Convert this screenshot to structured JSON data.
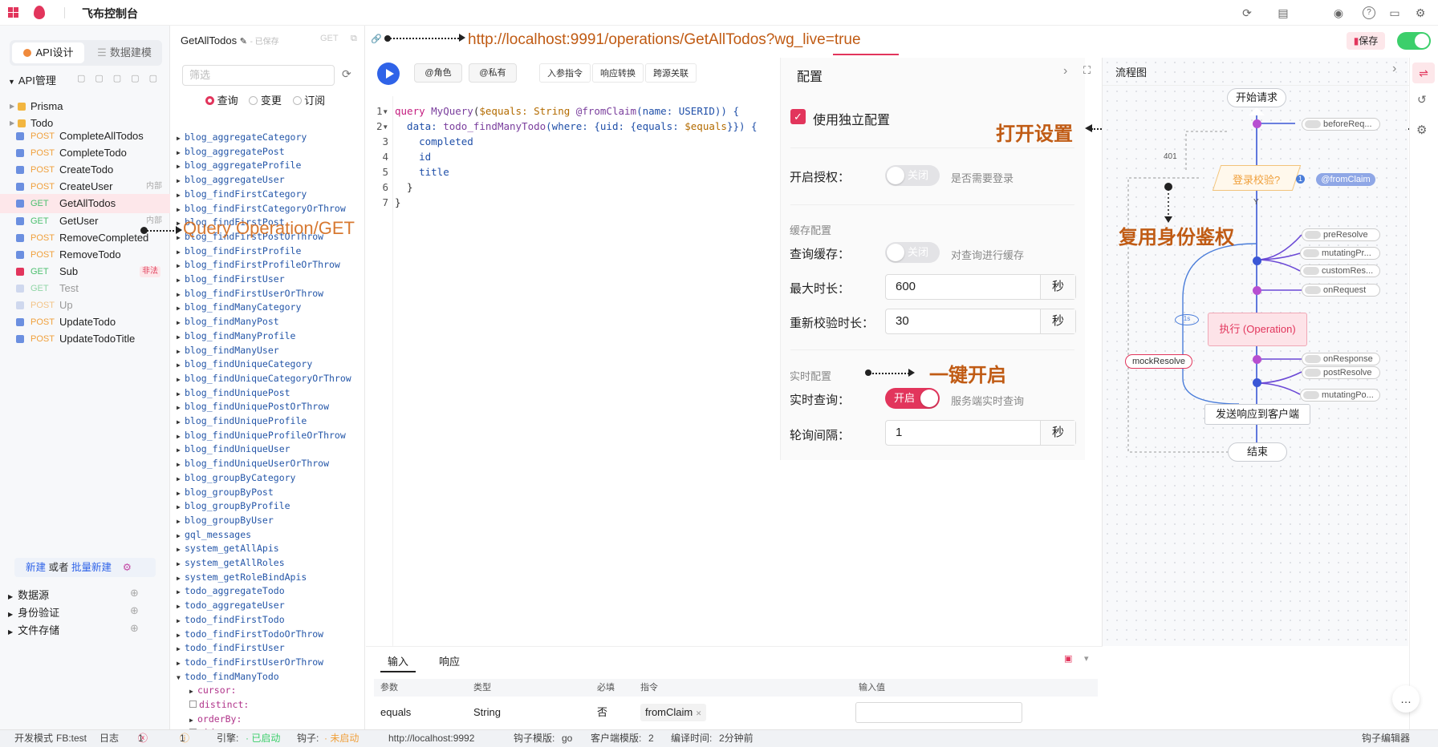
{
  "topbar": {
    "title": "飞布控制台",
    "save_label": "保存"
  },
  "left": {
    "tab_api": "API设计",
    "tab_data": "数据建模",
    "section_api": "API管理",
    "folders": [
      "Prisma",
      "Todo"
    ],
    "items": [
      {
        "method": "POST",
        "name": "CompleteAllTodos",
        "tag": ""
      },
      {
        "method": "POST",
        "name": "CompleteTodo",
        "tag": ""
      },
      {
        "method": "POST",
        "name": "CreateTodo",
        "tag": ""
      },
      {
        "method": "POST",
        "name": "CreateUser",
        "tag": "内部"
      },
      {
        "method": "GET",
        "name": "GetAllTodos",
        "tag": ""
      },
      {
        "method": "GET",
        "name": "GetUser",
        "tag": "内部"
      },
      {
        "method": "POST",
        "name": "RemoveCompleted",
        "tag": ""
      },
      {
        "method": "POST",
        "name": "RemoveTodo",
        "tag": ""
      },
      {
        "method": "GET",
        "name": "Sub",
        "tag": "非法"
      },
      {
        "method": "GET",
        "name": "Test",
        "tag": ""
      },
      {
        "method": "POST",
        "name": "Up",
        "tag": ""
      },
      {
        "method": "POST",
        "name": "UpdateTodo",
        "tag": ""
      },
      {
        "method": "POST",
        "name": "UpdateTodoTitle",
        "tag": ""
      }
    ],
    "new_label": "新建",
    "or_label": "或者",
    "batch_label": "批量新建",
    "sections": [
      "数据源",
      "身份验证",
      "文件存储"
    ]
  },
  "header": {
    "op_name": "GetAllTodos",
    "saved": "- 已保存",
    "method": "GET",
    "url": "http://localhost:9991/operations/GetAllTodos?wg_live=true"
  },
  "oplist": {
    "filter_placeholder": "筛选",
    "radios": [
      "查询",
      "变更",
      "订阅"
    ],
    "items": [
      "blog_aggregateCategory",
      "blog_aggregatePost",
      "blog_aggregateProfile",
      "blog_aggregateUser",
      "blog_findFirstCategory",
      "blog_findFirstCategoryOrThrow",
      "blog_findFirstPost",
      "blog_findFirstPostOrThrow",
      "blog_findFirstProfile",
      "blog_findFirstProfileOrThrow",
      "blog_findFirstUser",
      "blog_findFirstUserOrThrow",
      "blog_findManyCategory",
      "blog_findManyPost",
      "blog_findManyProfile",
      "blog_findManyUser",
      "blog_findUniqueCategory",
      "blog_findUniqueCategoryOrThrow",
      "blog_findUniquePost",
      "blog_findUniquePostOrThrow",
      "blog_findUniqueProfile",
      "blog_findUniqueProfileOrThrow",
      "blog_findUniqueUser",
      "blog_findUniqueUserOrThrow",
      "blog_groupByCategory",
      "blog_groupByPost",
      "blog_groupByProfile",
      "blog_groupByUser",
      "gql_messages",
      "system_getAllApis",
      "system_getAllRoles",
      "system_getRoleBindApis",
      "todo_aggregateTodo",
      "todo_aggregateUser",
      "todo_findFirstTodo",
      "todo_findFirstTodoOrThrow",
      "todo_findFirstUser",
      "todo_findFirstUserOrThrow",
      "todo_findManyTodo"
    ],
    "sub_items": [
      "cursor:",
      "distinct:",
      "orderBy:",
      "skip:"
    ]
  },
  "toolbar": {
    "role": "@角色",
    "private": "@私有",
    "input_directive": "入参指令",
    "response_transform": "响应转换",
    "cross_source": "跨源关联"
  },
  "code": {
    "line1": [
      "query ",
      "MyQuery",
      "(",
      "$equals",
      ": String ",
      "@fromClaim",
      "(name: USERID)) {"
    ],
    "line2": [
      "  data: ",
      "todo_findManyTodo",
      "(where: {uid: {equals: ",
      "$equals",
      "}}) {"
    ],
    "line3": "    completed",
    "line4": "    id",
    "line5": "    title",
    "line6": "  }",
    "line7": "}"
  },
  "config": {
    "title": "配置",
    "use_standalone": "使用独立配置",
    "auth_label": "开启授权：",
    "off": "关闭",
    "on": "开启",
    "auth_desc": "是否需要登录",
    "cache_section": "缓存配置",
    "cache_label": "查询缓存：",
    "cache_desc": "对查询进行缓存",
    "max_age_label": "最大时长：",
    "max_age": "600",
    "revalidate_label": "重新校验时长：",
    "revalidate": "30",
    "sec": "秒",
    "live_section": "实时配置",
    "live_label": "实时查询：",
    "live_desc": "服务端实时查询",
    "poll_label": "轮询间隔：",
    "poll": "1"
  },
  "annotations": {
    "open_settings": "打开设置",
    "reuse_auth": "复用身份鉴权",
    "one_click": "一键开启",
    "query_op": "Query Operation/GET"
  },
  "flow": {
    "title": "流程图",
    "start": "开始请求",
    "login_check": "登录校验?",
    "from_claim": "@fromClaim",
    "code_401": "401",
    "yes": "Y",
    "exec": "执行 (Operation)",
    "mock": "mockResolve",
    "send": "发送响应到客户端",
    "end": "结束",
    "one_s": "1s",
    "badge": "1",
    "hooks": [
      "beforeReq...",
      "preResolve",
      "mutatingPr...",
      "customRes...",
      "onRequest",
      "onResponse",
      "postResolve",
      "mutatingPo..."
    ]
  },
  "bottom": {
    "tab_input": "输入",
    "tab_response": "响应",
    "headers": [
      "参数",
      "类型",
      "必填",
      "指令",
      "输入值"
    ],
    "row": {
      "param": "equals",
      "type": "String",
      "required": "否",
      "directive": "fromClaim"
    }
  },
  "status": {
    "mode": "开发模式",
    "fb": "FB:test",
    "log": "日志",
    "errors": "1",
    "warnings": "1",
    "engine_label": "引擎:",
    "engine_status": "· 已启动",
    "hook_label": "钩子:",
    "hook_status": "· 未启动",
    "url": "http://localhost:9992",
    "hook_tpl_label": "钩子模版:",
    "hook_tpl": "go",
    "client_tpl_label": "客户端模版:",
    "client_tpl": "2",
    "compile_label": "编译时间:",
    "compile": "2分钟前",
    "hook_editor": "钩子编辑器"
  },
  "colors": {
    "accent": "#e2355c",
    "blue": "#2f63e8",
    "annotation": "#c05b14",
    "get": "#4cbf6f",
    "post": "#f0a03c",
    "toggle_on": "#e2355c",
    "switch_green": "#3ccf6b"
  }
}
